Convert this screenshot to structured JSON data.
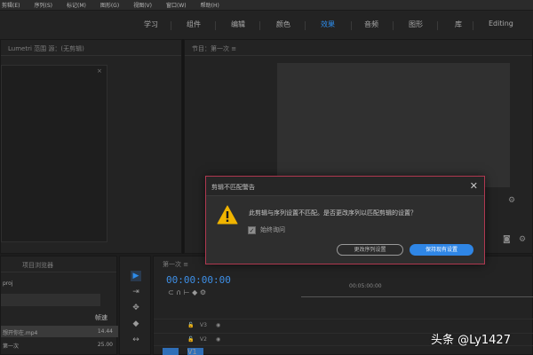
{
  "menubar": {
    "items": [
      "剪辑(E)",
      "序列(S)",
      "标记(M)",
      "图形(G)",
      "视图(V)",
      "窗口(W)",
      "帮助(H)"
    ]
  },
  "workspace": {
    "tabs": [
      "学习",
      "组件",
      "编辑",
      "颜色",
      "效果",
      "音频",
      "图形",
      "库",
      "Editing"
    ],
    "active": "效果"
  },
  "source_panel": {
    "header": "Lumetri 范围    源：(无剪辑)",
    "close_glyph": "×"
  },
  "program_panel": {
    "header": "节目：第一次 ≡"
  },
  "project_panel": {
    "header": "项目浏览器",
    "project_file": "proj",
    "column_header": "帧速",
    "rows": [
      {
        "name": "想开你在.mp4",
        "value": "14.44"
      },
      {
        "name": "第一次",
        "value": "25.00"
      }
    ]
  },
  "timeline": {
    "header": "第一次 ≡",
    "timecode": "00:00:00:00",
    "ruler_label": "00:05:00:00",
    "tracks": [
      "V3",
      "V2",
      "V1"
    ]
  },
  "dialog": {
    "title": "剪辑不匹配警告",
    "message": "此剪辑与序列设置不匹配。是否更改序列以匹配剪辑的设置？",
    "checkbox_label": "始终询问",
    "checkbox_checked": true,
    "secondary_button": "更改序列设置",
    "primary_button": "保持现有设置",
    "accent_color": "#b03850",
    "primary_color": "#2f86e6"
  },
  "watermark": "头条 @Ly1427"
}
